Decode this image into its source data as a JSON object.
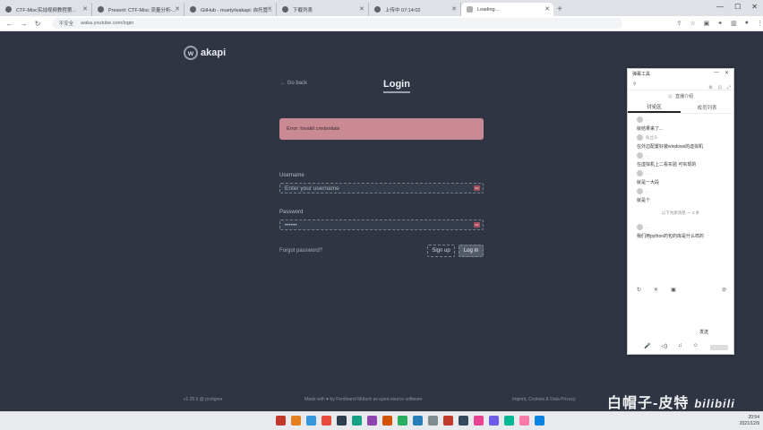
{
  "browser": {
    "tabs": [
      {
        "label": "CTF-Misc实战视频教程第..."
      },
      {
        "label": "Present: CTF-Misc 流量分析-..."
      },
      {
        "label": "GitHub - muety/wakapi: 自托管..."
      },
      {
        "label": "下载列表"
      },
      {
        "label": "上传中 07:14:02"
      },
      {
        "label": "Loading..."
      }
    ],
    "new_tab_label": "+",
    "security_label": "不安全",
    "url": "waka.youtube.com/login"
  },
  "page": {
    "logo_text": "akapi",
    "logo_mark": "w",
    "go_back": "← Go back",
    "title": "Login",
    "error": "Error: Invalid credentials",
    "username_label": "Username",
    "username_placeholder": "Enter your username",
    "password_label": "Password",
    "password_value": "••••••",
    "forgot": "Forgot password?",
    "signup_label": "Sign up",
    "login_label": "Log in",
    "footer_left": "v1.35.5 @ postgres",
    "footer_center": "Made with ♥ by Ferdinand Mütsch as open-source software",
    "footer_right": "Imprint, Cookies & Data Privacy"
  },
  "chat": {
    "title": "弹幕工具",
    "live_label": "直播介绍",
    "tabs": [
      "讨论区",
      "成员列表"
    ],
    "messages": [
      {
        "user": "...",
        "text": "就结果来了..."
      },
      {
        "user": "粉丝头",
        "text": "在外边配置好装windows的虚拟机"
      },
      {
        "user": "...",
        "text": "在虚拟机上二看实验 可实现的"
      },
      {
        "user": "...",
        "text": "就是一大段"
      },
      {
        "user": "...",
        "text": "就是个"
      }
    ],
    "divider": "以下为新消息 — 2 条",
    "last_message": {
      "user": "...",
      "text": "我们用python的包的库是什么样的"
    },
    "footer_label": "发送"
  },
  "watermark": {
    "text": "白帽子-皮特",
    "brand": "bilibili"
  },
  "taskbar": {
    "time": "20:54",
    "date": "2021/12/9",
    "apps": [
      {
        "name": "app-icon",
        "color": "#c0392b"
      },
      {
        "name": "app-icon",
        "color": "#e67e22"
      },
      {
        "name": "app-icon",
        "color": "#3498db"
      },
      {
        "name": "app-icon",
        "color": "#e74c3c"
      },
      {
        "name": "app-icon",
        "color": "#2c3e50"
      },
      {
        "name": "app-icon",
        "color": "#16a085"
      },
      {
        "name": "app-icon",
        "color": "#8e44ad"
      },
      {
        "name": "app-icon",
        "color": "#d35400"
      },
      {
        "name": "app-icon",
        "color": "#27ae60"
      },
      {
        "name": "app-icon",
        "color": "#2980b9"
      },
      {
        "name": "app-icon",
        "color": "#7f8c8d"
      },
      {
        "name": "app-icon",
        "color": "#c0392b"
      },
      {
        "name": "app-icon",
        "color": "#34495e"
      },
      {
        "name": "app-icon",
        "color": "#e84393"
      },
      {
        "name": "app-icon",
        "color": "#6c5ce7"
      },
      {
        "name": "app-icon",
        "color": "#00b894"
      },
      {
        "name": "app-icon",
        "color": "#fd79a8"
      },
      {
        "name": "app-icon",
        "color": "#0984e3"
      }
    ]
  }
}
